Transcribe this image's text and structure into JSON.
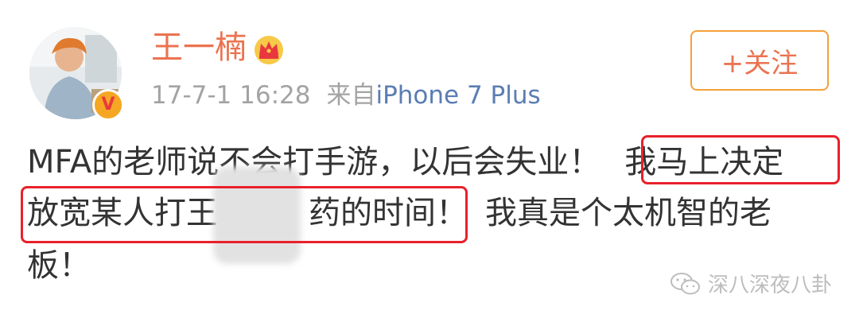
{
  "user": {
    "name": "王一楠",
    "avatar_icon": "avatar-photo",
    "verified_badge": "V",
    "vip_icon": "crown-icon"
  },
  "post_meta": {
    "time": "17-7-1 16:28",
    "source_prefix": "来自",
    "device": "iPhone 7 Plus"
  },
  "follow_button": {
    "label": "+关注"
  },
  "post": {
    "line1_plain": "MFA的老师说不会打手游，以后会失业！",
    "line1_highlight": "我马上决定",
    "line2_start": "放宽某人打王",
    "line2_end": "药的时间！",
    "line2_rest": "我真是个太机智的老",
    "line3": "板！"
  },
  "watermark": {
    "text": "深八深夜八卦",
    "icon": "wechat-icon"
  },
  "colors": {
    "name": "#eb7350",
    "device_link": "#5a7db3",
    "meta": "#a3a3a3",
    "highlight_box": "#e8212b",
    "button_border": "#f5a13a"
  }
}
